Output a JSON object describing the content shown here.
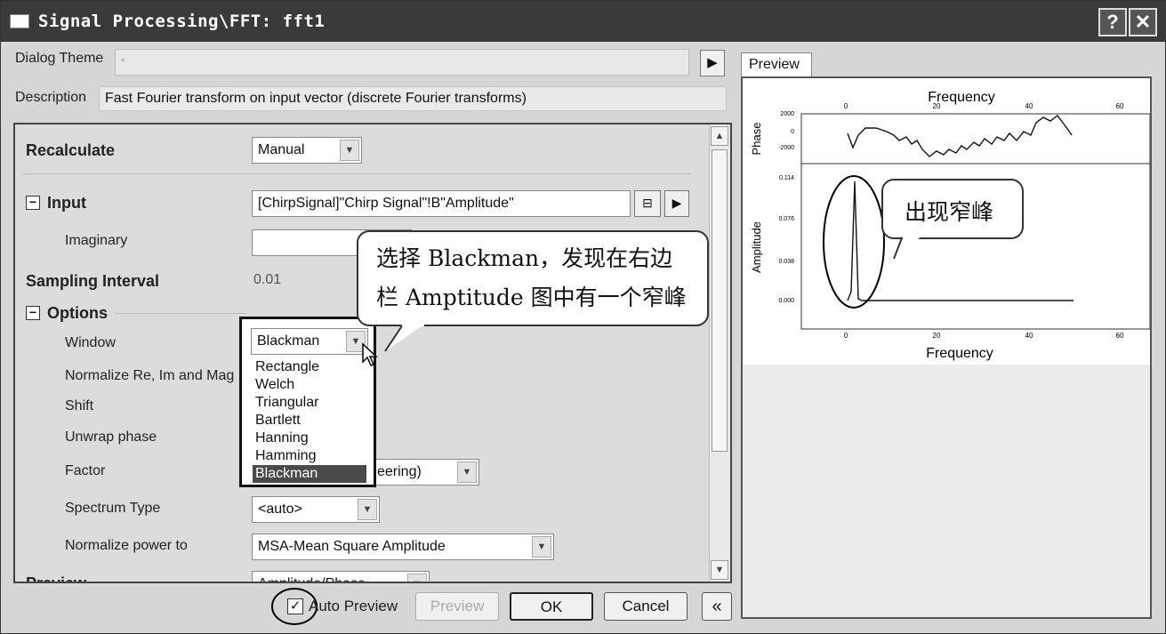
{
  "window": {
    "title": "Signal Processing\\FFT: fft1",
    "help": "?",
    "close": "✕"
  },
  "top": {
    "theme_label": "Dialog Theme",
    "theme_value": "*",
    "description_label": "Description",
    "description_value": "Fast Fourier transform on input vector (discrete Fourier transforms)"
  },
  "panel": {
    "recalculate_label": "Recalculate",
    "recalculate_value": "Manual",
    "input_label": "Input",
    "input_toggle": "−",
    "input_value": "[ChirpSignal]\"Chirp Signal\"!B\"Amplitude\"",
    "imaginary_label": "Imaginary",
    "imaginary_value": "",
    "sampling_label": "Sampling Interval",
    "sampling_value": "0.01",
    "options_label": "Options",
    "options_toggle": "−",
    "window_label": "Window",
    "window_value": "Blackman",
    "normalize_label": "Normalize Re, Im and Mag",
    "shift_label": "Shift",
    "unwrap_label": "Unwrap phase",
    "factor_label": "Factor",
    "factor_value": "eering)",
    "spectrum_label": "Spectrum Type",
    "spectrum_value": "<auto>",
    "normpower_label": "Normalize power to",
    "normpower_value": "MSA-Mean Square Amplitude",
    "preview_label_cut": "Preview",
    "preview_value_cut": "Amplitude/Phase"
  },
  "window_options": [
    "Rectangle",
    "Welch",
    "Triangular",
    "Bartlett",
    "Hanning",
    "Hamming",
    "Blackman"
  ],
  "window_selected_index": 6,
  "callouts": {
    "left_line1": "选择 Blackman，发现在右边",
    "left_line2": "栏 Amptitude 图中有一个窄峰",
    "right": "出现窄峰"
  },
  "bottom": {
    "auto_preview_label": "Auto Preview",
    "auto_preview_checked": true,
    "preview_button": "Preview",
    "ok_button": "OK",
    "cancel_button": "Cancel",
    "collapse_button": "«"
  },
  "preview": {
    "tab_label": "Preview",
    "top_axis_title": "Frequency",
    "bottom_axis_title": "Frequency",
    "phase_label": "Phase",
    "amplitude_label": "Amplitude",
    "x_ticks_top": [
      "0",
      "20",
      "40",
      "60"
    ],
    "x_ticks_bottom": [
      "0",
      "20",
      "40",
      "60"
    ],
    "phase_ticks": [
      "2000",
      "0",
      "-2000"
    ],
    "amp_ticks": [
      "0.114",
      "0.076",
      "0.038",
      "0.000"
    ]
  }
}
